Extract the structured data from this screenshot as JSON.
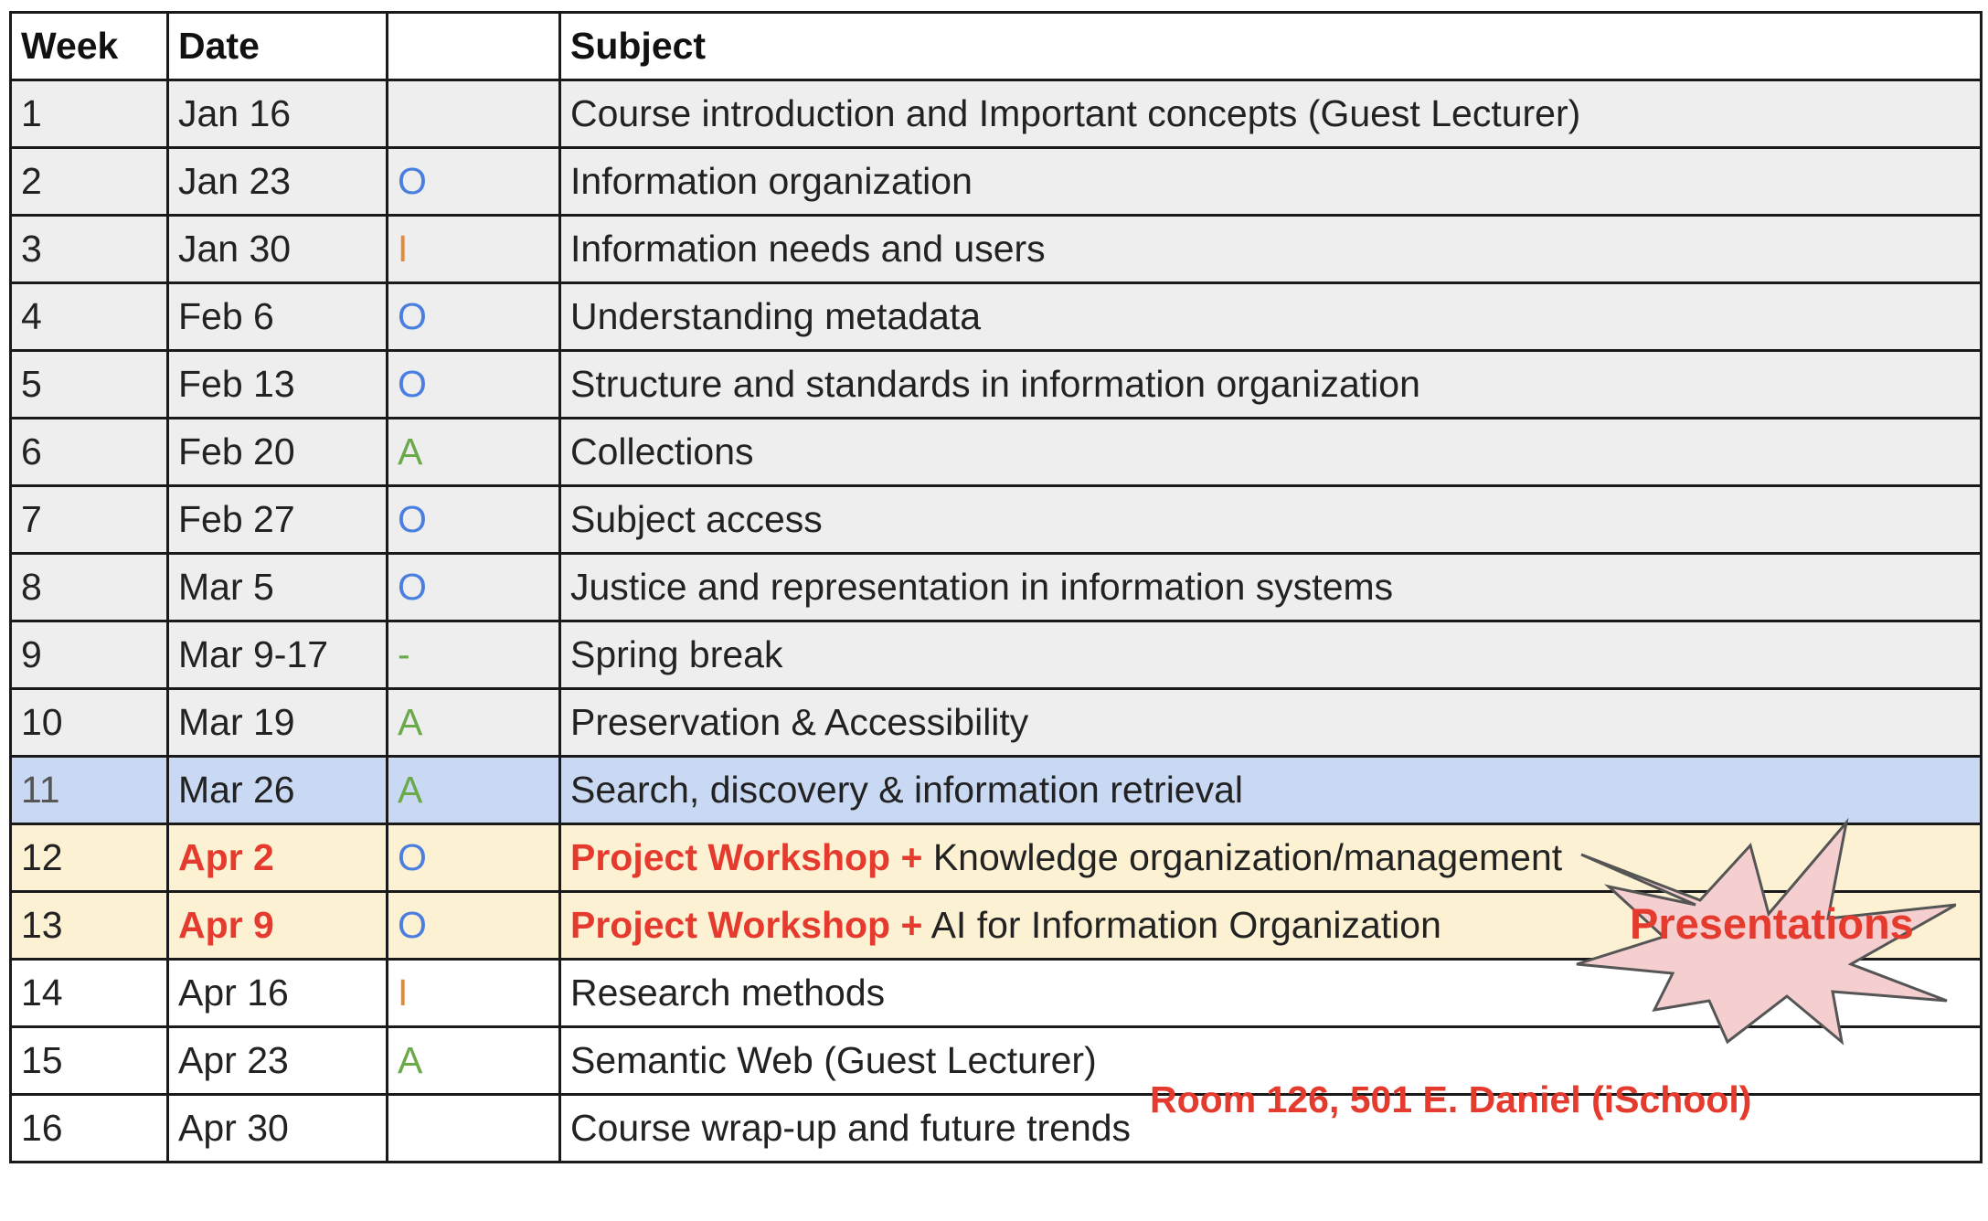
{
  "headers": {
    "week": "Week",
    "date": "Date",
    "type": "",
    "subject": "Subject"
  },
  "rows": [
    {
      "week": "1",
      "date": "Jan 16",
      "type": "",
      "subject": "Course introduction and Important concepts (Guest Lecturer)"
    },
    {
      "week": "2",
      "date": "Jan 23",
      "type": "O",
      "subject": "Information organization"
    },
    {
      "week": "3",
      "date": "Jan 30",
      "type": "I",
      "subject": "Information needs and users"
    },
    {
      "week": "4",
      "date": "Feb 6",
      "type": "O",
      "subject": "Understanding metadata"
    },
    {
      "week": "5",
      "date": "Feb 13",
      "type": "O",
      "subject": "Structure and standards in information organization"
    },
    {
      "week": "6",
      "date": "Feb 20",
      "type": "A",
      "subject": "Collections"
    },
    {
      "week": "7",
      "date": "Feb 27",
      "type": "O",
      "subject": "Subject access"
    },
    {
      "week": "8",
      "date": "Mar 5",
      "type": "O",
      "subject": "Justice and representation in information systems"
    },
    {
      "week": "9",
      "date": "Mar 9-17",
      "type": "-",
      "subject": "Spring break"
    },
    {
      "week": "10",
      "date": "Mar 19",
      "type": "A",
      "subject": "Preservation & Accessibility"
    },
    {
      "week": "11",
      "date": "Mar 26",
      "type": "A",
      "subject": "Search, discovery & information retrieval"
    },
    {
      "week": "12",
      "date": "Apr 2",
      "type": "O",
      "subject_prefix": "Project Workshop +",
      "subject": "Knowledge organization/management"
    },
    {
      "week": "13",
      "date": "Apr 9",
      "type": "O",
      "subject_prefix": "Project Workshop +",
      "subject": "AI for Information Organization"
    },
    {
      "week": "14",
      "date": "Apr 16",
      "type": "I",
      "subject": "Research methods"
    },
    {
      "week": "15",
      "date": "Apr 23",
      "type": "A",
      "subject": "Semantic Web (Guest Lecturer)"
    },
    {
      "week": "16",
      "date": "Apr 30",
      "type": "",
      "subject": "Course wrap-up and future trends"
    }
  ],
  "annotations": {
    "presentations": "Presentations",
    "room_note": "Room 126, 501 E. Daniel (iSchool)"
  },
  "colors": {
    "row_gray": "#eeeeee",
    "row_highlight_blue": "#c9d9f3",
    "row_highlight_yellow": "#fcf1d2",
    "accent_red": "#e53a2e",
    "type_O": "#4a7ee0",
    "type_I": "#e08a3c",
    "type_A": "#6aaa4a",
    "burst_fill": "#f5cfcf"
  }
}
